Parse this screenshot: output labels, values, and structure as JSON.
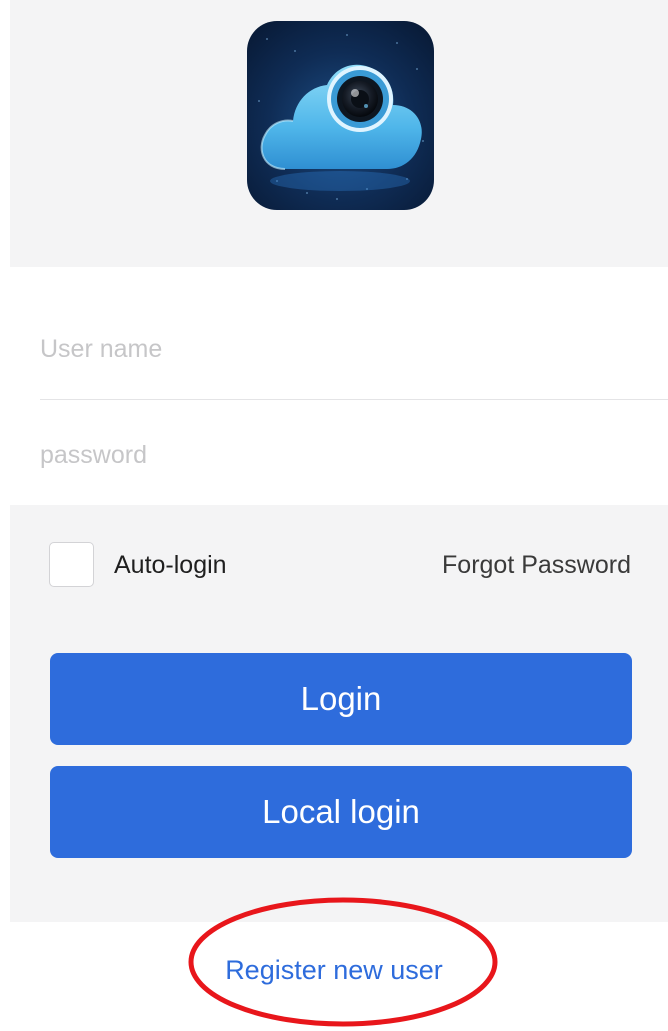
{
  "app": {
    "logo_icon": "cloud-camera-icon"
  },
  "login_form": {
    "username_placeholder": "User name",
    "password_placeholder": "password",
    "auto_login_label": "Auto-login",
    "auto_login_checked": false,
    "forgot_password_label": "Forgot Password",
    "login_button_label": "Login",
    "local_login_button_label": "Local login",
    "register_link_label": "Register new user"
  },
  "colors": {
    "accent": "#2e6cdc",
    "background_band": "#f4f4f5",
    "annotation": "#e8161b"
  },
  "annotation": {
    "shape": "ellipse",
    "target": "register-link"
  }
}
